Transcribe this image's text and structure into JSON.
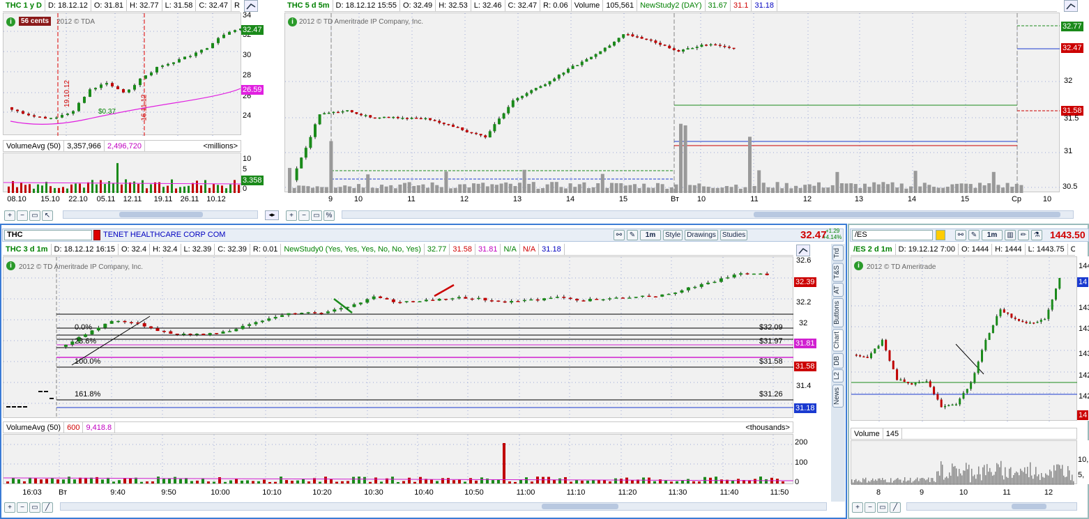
{
  "topLeft": {
    "header": [
      "THC 1 y D",
      "D: 18.12.12",
      "O: 31.81",
      "H: 32.77",
      "L: 31.58",
      "C: 32.47",
      "R:..."
    ],
    "badge": "56 cents",
    "copyright": "2012 © TDA",
    "price_tag": "32.47",
    "ma_tag": "26.59",
    "yticks": [
      "34",
      "32",
      "30",
      "28",
      "26",
      "24"
    ],
    "annot1": "19.10.12",
    "annot2": "16.11.12",
    "annot3": "$0.37",
    "vol_header": [
      "VolumeAvg (50)",
      "3,357,966",
      "2,496,720",
      "<millions>"
    ],
    "vol_tag": "3.358",
    "vol_yticks": [
      "10",
      "5",
      "0"
    ],
    "xticks": [
      "08.10",
      "15.10",
      "22.10",
      "05.11",
      "12.11",
      "19.11",
      "26.11",
      "10.12"
    ]
  },
  "topRight": {
    "header": [
      "THC 5 d 5m",
      "D: 18.12.12 15:55",
      "O: 32.49",
      "H: 32.53",
      "L: 32.46",
      "C: 32.47",
      "R: 0.06",
      "Volume",
      "105,561",
      "NewStudy2 (DAY)",
      "31.67",
      "31.1",
      "31.18"
    ],
    "copyright": "2012 © TD Ameritrade IP Company, Inc.",
    "tags": [
      "32.77",
      "32.47",
      "31.58"
    ],
    "yticks": [
      "32",
      "31.5",
      "31",
      "30.5"
    ],
    "xticks": [
      "9",
      "10",
      "11",
      "12",
      "13",
      "14",
      "15",
      "Вт",
      "10",
      "11",
      "12",
      "13",
      "14",
      "15",
      "Ср",
      "10"
    ]
  },
  "main": {
    "symbol": "THC",
    "company": "TENET HEALTHCARE CORP COM",
    "toolbar": {
      "interval": "1m",
      "style": "Style",
      "drawings": "Drawings",
      "studies": "Studies",
      "price": "32.47",
      "chg": "+1.29",
      "pct": "+4.14%"
    },
    "header": [
      "THC 3 d 1m",
      "D: 18.12.12 16:15",
      "O: 32.4",
      "H: 32.4",
      "L: 32.39",
      "C: 32.39",
      "R: 0.01",
      "NewStudy0 (Yes, Yes, Yes, No, No, Yes)",
      "32.77",
      "31.58",
      "31.81",
      "N/A",
      "N/A",
      "31.18"
    ],
    "copyright": "2012 © TD Ameritrade IP Company, Inc.",
    "tags": [
      "32.39",
      "31.81",
      "31.58",
      "31.18"
    ],
    "yticks": [
      "32.6",
      "32.4",
      "32.2",
      "32",
      "31.8",
      "31.6",
      "31.4",
      "31.2"
    ],
    "fib": [
      {
        "pct": "0.0%",
        "price": "$32.09"
      },
      {
        "pct": "23.6%",
        "price": "$31.97"
      },
      {
        "pct": "100.0%",
        "price": "$31.58"
      },
      {
        "pct": "161.8%",
        "price": "$31.26"
      }
    ],
    "vol_header": [
      "VolumeAvg (50)",
      "600",
      "9,418.8",
      "<thousands>"
    ],
    "vol_yticks": [
      "200",
      "100",
      "0"
    ],
    "xticks": [
      "16:03",
      "Вт",
      "9:40",
      "9:50",
      "10:00",
      "10:10",
      "10:20",
      "10:30",
      "10:40",
      "10:50",
      "11:00",
      "11:10",
      "11:20",
      "11:30",
      "11:40",
      "11:50"
    ],
    "side_tabs": [
      "Trd",
      "T&S",
      "AT",
      "Buttons",
      "Chart",
      "DB",
      "L2",
      "News"
    ]
  },
  "es": {
    "symbol": "/ES",
    "interval": "1m",
    "price": "1443.50",
    "header": [
      "/ES 2 d 1m",
      "D: 19.12.12 7:00",
      "O: 1444",
      "H: 1444",
      "L: 1443.75",
      "C..."
    ],
    "copyright": "2012 © TD Ameritrade",
    "yticks": [
      "144",
      "143",
      "143",
      "143",
      "142",
      "142"
    ],
    "vol_header": [
      "Volume",
      "145"
    ],
    "vol_yticks": [
      "10,",
      "5,"
    ],
    "xticks": [
      "8",
      "9",
      "10",
      "11",
      "12"
    ]
  },
  "colors": {
    "up": "#1a7f1a",
    "down": "#c00000",
    "panel": "#f1f1f1",
    "frame": "#3a7bd5"
  }
}
